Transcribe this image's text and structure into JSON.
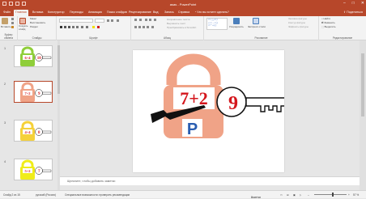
{
  "app": {
    "title": "asas - PowerPoint",
    "qat": [
      "save",
      "undo",
      "redo",
      "start"
    ],
    "window_buttons": [
      "minimize-icon",
      "maximize-icon",
      "close-icon"
    ]
  },
  "tabs": [
    {
      "label": "Файл",
      "active": false
    },
    {
      "label": "Главная",
      "active": true
    },
    {
      "label": "Вставка",
      "active": false
    },
    {
      "label": "Конструктор",
      "active": false
    },
    {
      "label": "Переходы",
      "active": false
    },
    {
      "label": "Анимация",
      "active": false
    },
    {
      "label": "Показ слайдов",
      "active": false
    },
    {
      "label": "Рецензирование",
      "active": false
    },
    {
      "label": "Вид",
      "active": false
    },
    {
      "label": "Запись",
      "active": false
    },
    {
      "label": "Справка",
      "active": false
    },
    {
      "label": "Что вы хотите сделать?",
      "active": false
    }
  ],
  "share_label": "Поделиться",
  "ribbon": {
    "clipboard": {
      "label": "Буфер обмена",
      "paste": "Вставить"
    },
    "slides": {
      "label": "Слайды",
      "new_slide": "Создать слайд",
      "layout": "Макет",
      "reset": "Восстановить",
      "section": "Раздел"
    },
    "font": {
      "label": "Шрифт"
    },
    "paragraph": {
      "label": "Абзац",
      "text_direction": "Направление текста",
      "align_text": "Выровнять текст",
      "smartart": "Преобразовать в SmartArt"
    },
    "drawing": {
      "label": "Рисование",
      "arrange": "Упорядочить",
      "quick_styles": "Экспресс-стили",
      "fill": "Заливка фигуры",
      "outline": "Контур фигуры",
      "effects": "Эффекты фигуры"
    },
    "editing": {
      "label": "Редактирование",
      "find": "Найти",
      "replace": "Заменить",
      "select": "Выделить"
    }
  },
  "slides": [
    {
      "number": "1",
      "lock_color": "#8fce3a",
      "key_number": "10",
      "label": "6+4"
    },
    {
      "number": "2",
      "lock_color": "#f0a387",
      "key_number": "9",
      "label": "7+2"
    },
    {
      "number": "3",
      "lock_color": "#f5d13a",
      "key_number": "8",
      "label": "4+4"
    },
    {
      "number": "4",
      "lock_color": "#f0ec1a",
      "key_number": "7",
      "label": "5+2"
    }
  ],
  "main_slide": {
    "equation": "7+2",
    "letter": "P",
    "key_number": "9",
    "lock_color": "#f0a387",
    "key_color": "#ffffff"
  },
  "notes_placeholder": "Щелкните, чтобы добавить заметки",
  "status": {
    "slide_info": "Слайд 2 из 15",
    "language": "русский (Россия)",
    "accessibility": "Специальные возможности: проверить рекомендации",
    "notes": "Заметки",
    "zoom": "57 %"
  }
}
